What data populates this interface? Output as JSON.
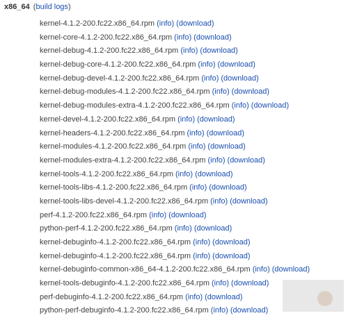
{
  "arch": {
    "label": "x86_64",
    "open_paren": "(",
    "build_logs_label": "build logs",
    "close_paren": ")"
  },
  "rpms": [
    {
      "name": "kernel-4.1.2-200.fc22.x86_64.rpm",
      "info": "(info)",
      "download": "(download)"
    },
    {
      "name": "kernel-core-4.1.2-200.fc22.x86_64.rpm",
      "info": "(info)",
      "download": "(download)"
    },
    {
      "name": "kernel-debug-4.1.2-200.fc22.x86_64.rpm",
      "info": "(info)",
      "download": "(download)"
    },
    {
      "name": "kernel-debug-core-4.1.2-200.fc22.x86_64.rpm",
      "info": "(info)",
      "download": "(download)"
    },
    {
      "name": "kernel-debug-devel-4.1.2-200.fc22.x86_64.rpm",
      "info": "(info)",
      "download": "(download)"
    },
    {
      "name": "kernel-debug-modules-4.1.2-200.fc22.x86_64.rpm",
      "info": "(info)",
      "download": "(download)"
    },
    {
      "name": "kernel-debug-modules-extra-4.1.2-200.fc22.x86_64.rpm",
      "info": "(info)",
      "download": "(download)"
    },
    {
      "name": "kernel-devel-4.1.2-200.fc22.x86_64.rpm",
      "info": "(info)",
      "download": "(download)"
    },
    {
      "name": "kernel-headers-4.1.2-200.fc22.x86_64.rpm",
      "info": "(info)",
      "download": "(download)"
    },
    {
      "name": "kernel-modules-4.1.2-200.fc22.x86_64.rpm",
      "info": "(info)",
      "download": "(download)"
    },
    {
      "name": "kernel-modules-extra-4.1.2-200.fc22.x86_64.rpm",
      "info": "(info)",
      "download": "(download)"
    },
    {
      "name": "kernel-tools-4.1.2-200.fc22.x86_64.rpm",
      "info": "(info)",
      "download": "(download)"
    },
    {
      "name": "kernel-tools-libs-4.1.2-200.fc22.x86_64.rpm",
      "info": "(info)",
      "download": "(download)"
    },
    {
      "name": "kernel-tools-libs-devel-4.1.2-200.fc22.x86_64.rpm",
      "info": "(info)",
      "download": "(download)"
    },
    {
      "name": "perf-4.1.2-200.fc22.x86_64.rpm",
      "info": "(info)",
      "download": "(download)"
    },
    {
      "name": "python-perf-4.1.2-200.fc22.x86_64.rpm",
      "info": "(info)",
      "download": "(download)"
    },
    {
      "name": "kernel-debuginfo-4.1.2-200.fc22.x86_64.rpm",
      "info": "(info)",
      "download": "(download)"
    },
    {
      "name": "kernel-debuginfo-4.1.2-200.fc22.x86_64.rpm",
      "info": "(info)",
      "download": "(download)"
    },
    {
      "name": "kernel-debuginfo-common-x86_64-4.1.2-200.fc22.x86_64.rpm",
      "info": "(info)",
      "download": "(download)"
    },
    {
      "name": "kernel-tools-debuginfo-4.1.2-200.fc22.x86_64.rpm",
      "info": "(info)",
      "download": "(download)"
    },
    {
      "name": "perf-debuginfo-4.1.2-200.fc22.x86_64.rpm",
      "info": "(info)",
      "download": "(download)"
    },
    {
      "name": "python-perf-debuginfo-4.1.2-200.fc22.x86_64.rpm",
      "info": "(info)",
      "download": "(download)"
    }
  ],
  "colors": {
    "link": "#1a4fb0",
    "text": "#404040"
  }
}
